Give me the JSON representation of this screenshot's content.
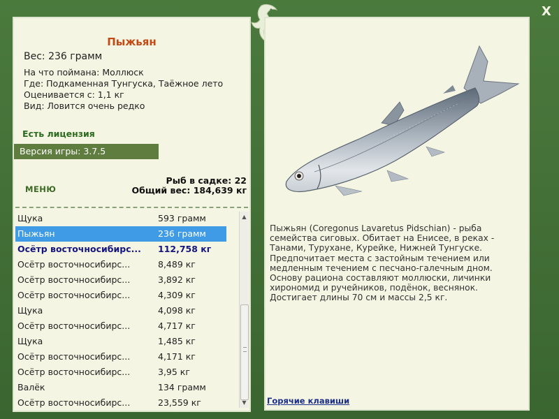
{
  "window": {
    "close_label": "X"
  },
  "fish": {
    "title": "Пыжьян",
    "weight": "Вес: 236 грамм",
    "details": [
      "На что поймана: Моллюск",
      "Где: Подкаменная Тунгуска, Таёжное лето",
      "Оценивается с: 1,1 кг",
      "Вид: Ловится очень редко"
    ],
    "description": "Пыжьян (Coregonus Lavaretus Pidschian) - рыба семейства сиговых. Обитает на Енисее, в реках - Танами, Турухане, Курейке, Нижней Тунгуске. Предпочитает места с застойным течением или медленным течением с песчано-галечным дном. Основу рациона составляют моллюски, личинки хирономид и ручейников, подёнок, веснянок. Достигает длины 70 см и массы 2,5 кг."
  },
  "license": "Есть лицензия",
  "version": "Версия игры: 3.7.5",
  "menu_label": "МЕНЮ",
  "stats": {
    "count": "Рыб в садке: 22",
    "total": "Общий вес: 184,639 кг"
  },
  "catch_list": [
    {
      "name": "Щука",
      "weight": "593 грамм"
    },
    {
      "name": "Пыжьян",
      "weight": "236 грамм"
    },
    {
      "name": "Осётр восточносибирс...",
      "weight": "112,758 кг"
    },
    {
      "name": "Осётр восточносибирс...",
      "weight": "8,489 кг"
    },
    {
      "name": "Осётр восточносибирс...",
      "weight": "3,892 кг"
    },
    {
      "name": "Осётр восточносибирс...",
      "weight": "4,309 кг"
    },
    {
      "name": "Щука",
      "weight": "4,098 кг"
    },
    {
      "name": "Осётр восточносибирс...",
      "weight": "4,717 кг"
    },
    {
      "name": "Щука",
      "weight": "1,485 кг"
    },
    {
      "name": "Осётр восточносибирс...",
      "weight": "4,171 кг"
    },
    {
      "name": "Осётр восточносибирс...",
      "weight": "3,95 кг"
    },
    {
      "name": "Валёк",
      "weight": "134 грамм"
    },
    {
      "name": "Осётр восточносибирс...",
      "weight": "23,559 кг"
    }
  ],
  "hotkeys_label": "Горячие клавиши",
  "colors": {
    "frame": "#3f6b34",
    "panel": "#f5f5e3",
    "title": "#c24a14",
    "selected": "#3f9be6",
    "record": "#151580",
    "version_bar": "#5e7d3e"
  },
  "icons": {
    "close": "close-icon",
    "logo": "fish-logo-icon",
    "scroll_up": "arrow-up-icon",
    "scroll_down": "arrow-down-icon"
  }
}
